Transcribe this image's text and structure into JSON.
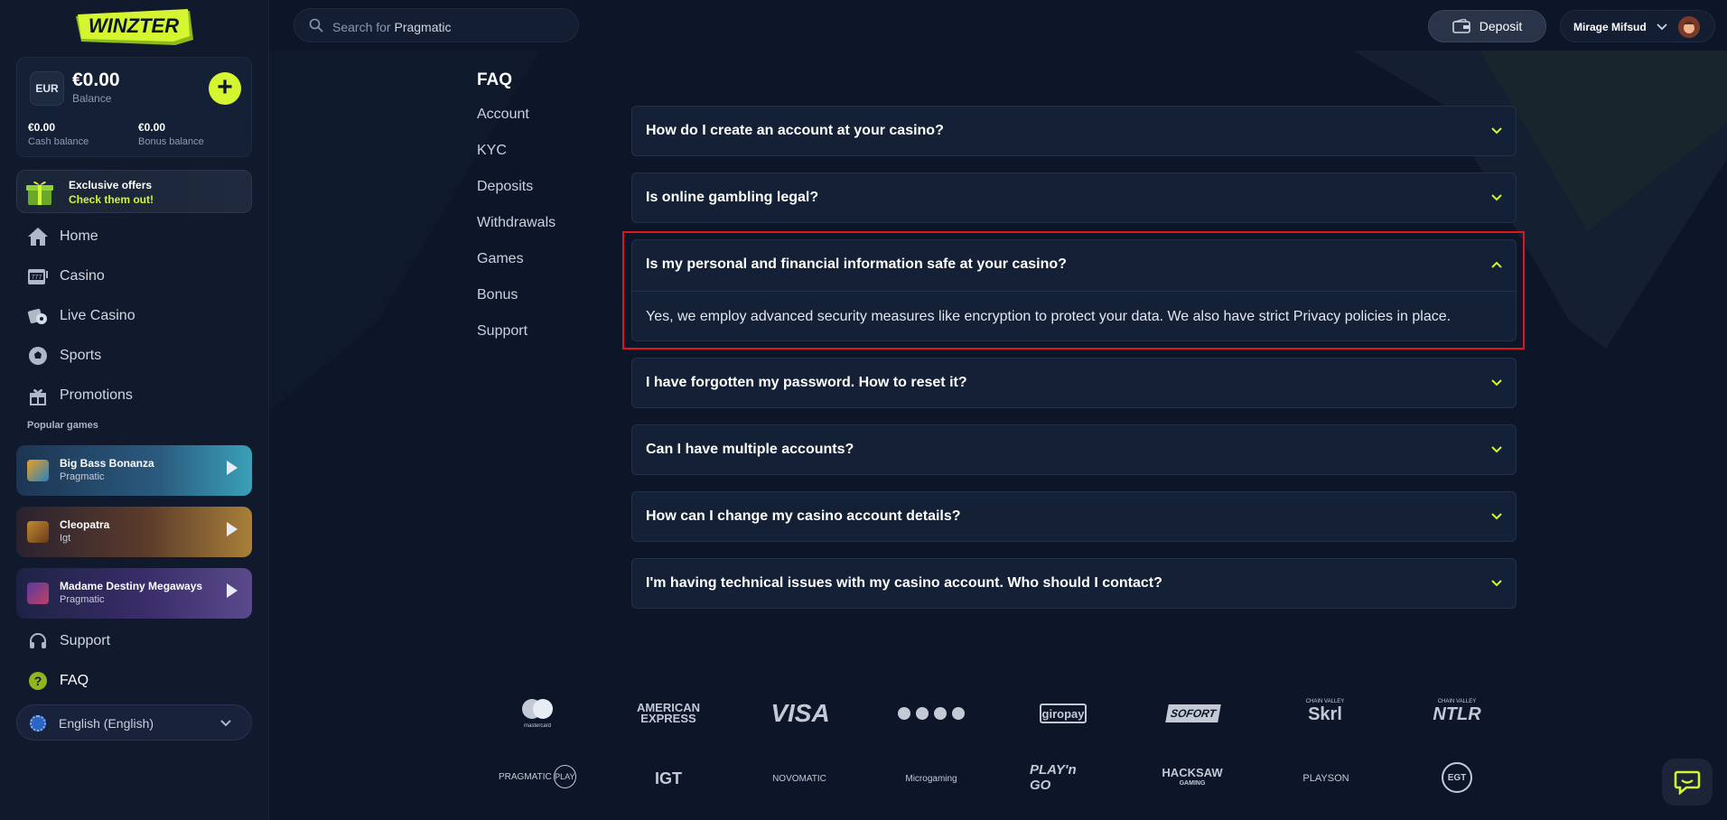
{
  "brand": {
    "logo_text": "WINZTER",
    "accent": "#d4f530",
    "highlight": "#e0161d"
  },
  "wallet": {
    "currency": "EUR",
    "balance": "€0.00",
    "balance_label": "Balance",
    "cash": "€0.00",
    "cash_label": "Cash balance",
    "bonus": "€0.00",
    "bonus_label": "Bonus balance"
  },
  "offers": {
    "title": "Exclusive offers",
    "cta": "Check them out!"
  },
  "nav": [
    {
      "label": "Home",
      "icon": "home-icon"
    },
    {
      "label": "Casino",
      "icon": "slot-machine-icon"
    },
    {
      "label": "Live Casino",
      "icon": "chips-icon"
    },
    {
      "label": "Sports",
      "icon": "soccer-ball-icon"
    },
    {
      "label": "Promotions",
      "icon": "gift-icon"
    }
  ],
  "popular": {
    "title": "Popular games",
    "games": [
      {
        "name": "Big Bass Bonanza",
        "provider": "Pragmatic"
      },
      {
        "name": "Cleopatra",
        "provider": "Igt"
      },
      {
        "name": "Madame Destiny Megaways",
        "provider": "Pragmatic"
      }
    ]
  },
  "bottom_nav": [
    {
      "label": "Support",
      "icon": "headset-icon"
    },
    {
      "label": "FAQ",
      "icon": "question-icon"
    }
  ],
  "language": "English (English)",
  "search": {
    "prefix": "Search for ",
    "term": "Pragmatic"
  },
  "header": {
    "deposit": "Deposit",
    "user": "Mirage Mifsud"
  },
  "faq": {
    "title": "FAQ",
    "categories": [
      "Account",
      "KYC",
      "Deposits",
      "Withdrawals",
      "Games",
      "Bonus",
      "Support"
    ],
    "questions": [
      {
        "q": "How do I create an account at your casino?",
        "open": false
      },
      {
        "q": "Is online gambling legal?",
        "open": false
      },
      {
        "q": "Is my personal and financial information safe at your casino?",
        "open": true,
        "a": "Yes, we employ advanced security measures like encryption to protect your data. We also have strict Privacy policies in place."
      },
      {
        "q": "I have forgotten my password. How to reset it?",
        "open": false
      },
      {
        "q": "Can I have multiple accounts?",
        "open": false
      },
      {
        "q": "How can I change my casino account details?",
        "open": false
      },
      {
        "q": "I'm having technical issues with my casino account. Who should I contact?",
        "open": false
      }
    ]
  },
  "payment_logos": {
    "row1": [
      "mastercard",
      "AMERICAN EXPRESS",
      "VISA",
      "crypto",
      "giropay",
      "SOFORT",
      "Skrl",
      "NTLR"
    ],
    "row2": [
      "PRAGMATIC PLAY",
      "IGT",
      "NOVOMATIC",
      "Microgaming",
      "PLAY'n GO",
      "HACKSAW GAMING",
      "PLAYSON",
      "EGT"
    ]
  },
  "logo_text": {
    "mastercard": "mastercard",
    "amex_1": "AMERICAN",
    "amex_2": "EXPRESS",
    "visa": "VISA",
    "giropay": "giropay",
    "sofort": "SOFORT",
    "chain_valley": "CHAIN VALLEY",
    "skrl": "Skrl",
    "ntlr": "NTLR",
    "pragmatic_1": "PRAGMATIC",
    "pragmatic_2": "PLAY",
    "igt": "IGT",
    "novomatic": "NOVOMATIC",
    "microgaming": "Microgaming",
    "playngo": "PLAY'n GO",
    "hacksaw_1": "HACKSAW",
    "hacksaw_2": "GAMING",
    "playson": "PLAYSON",
    "egt": "EGT"
  }
}
